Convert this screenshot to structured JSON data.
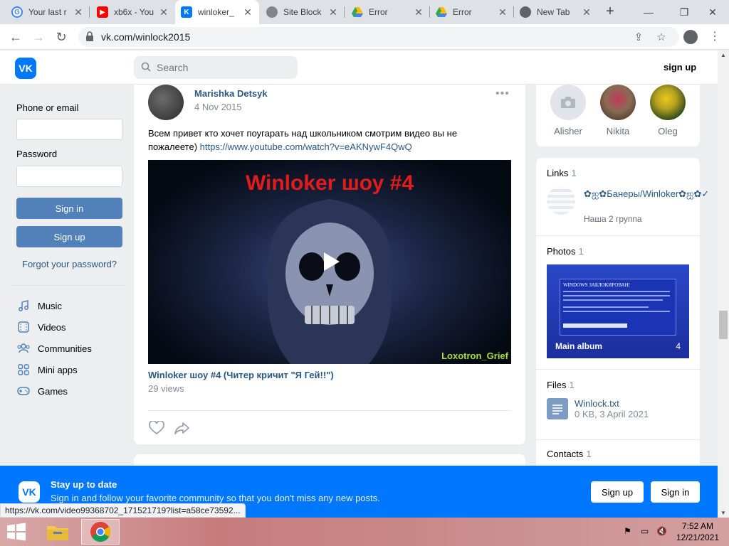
{
  "browser": {
    "tabs": [
      {
        "title": "Your last r",
        "favicon": "google-icon",
        "color": "#4285f4"
      },
      {
        "title": "xb6x - You",
        "favicon": "youtube-icon",
        "color": "#ff0000"
      },
      {
        "title": "winloker_",
        "favicon": "vk-icon",
        "color": "#0077ff"
      },
      {
        "title": "Site Block",
        "favicon": "blocked-site-icon",
        "color": "#5f6368"
      },
      {
        "title": "Error",
        "favicon": "google-drive-icon",
        "color": "#fbbc04"
      },
      {
        "title": "Error",
        "favicon": "google-drive-icon",
        "color": "#fbbc04"
      },
      {
        "title": "New Tab",
        "favicon": "chrome-icon",
        "color": "#5f6368"
      }
    ],
    "new_tab_label": "+",
    "url": "vk.com/winlock2015",
    "status_url": "https://vk.com/video99368702_171521719?list=a58ce73592..."
  },
  "vk": {
    "logo_text": "VK",
    "search_placeholder": "Search",
    "signup_top": "sign up",
    "login": {
      "phone_label": "Phone or email",
      "password_label": "Password",
      "signin_button": "Sign in",
      "signup_button": "Sign up",
      "forgot_link": "Forgot your password?"
    },
    "menu": [
      {
        "label": "Music",
        "icon": "music-note-icon"
      },
      {
        "label": "Videos",
        "icon": "video-icon"
      },
      {
        "label": "Communities",
        "icon": "communities-icon"
      },
      {
        "label": "Mini apps",
        "icon": "mini-apps-icon"
      },
      {
        "label": "Games",
        "icon": "gamepad-icon"
      }
    ],
    "post": {
      "author": "Marishka Detsyk",
      "date": "4 Nov 2015",
      "text": "Всем привет кто хочет поугарать над школьником смотрим видео вы не пожалеете)",
      "link": "https://www.youtube.com/watch?v=eAKNywF4QwQ",
      "video_title_overlay": "Winloker шоу #4",
      "video_watermark": "Loxotron_Grief",
      "video_caption": "Winloker шоу #4 (Читер кричит \"Я Гей!!\")",
      "views": "29 views"
    },
    "friends": [
      {
        "name": "Alisher",
        "color": "#dfe3e8"
      },
      {
        "name": "Nikita",
        "color": "#8a6b55"
      },
      {
        "name": "Oleg",
        "color": "#2c4a1a"
      }
    ],
    "links": {
      "title": "Links",
      "count": "1",
      "item_title": "✿ஐ✿Банеры/Winloker✿ஐ✿✓",
      "item_sub": "Наша 2 группа"
    },
    "photos": {
      "title": "Photos",
      "count": "1",
      "album_name": "Main album",
      "album_count": "4",
      "thumb_heading": "WINDOWS ЗАБЛОКИРОВАН!"
    },
    "files": {
      "title": "Files",
      "count": "1",
      "file_name": "Winlock.txt",
      "file_meta": "0 KB, 3 April 2021"
    },
    "contacts": {
      "title": "Contacts",
      "count": "1"
    },
    "banner": {
      "title": "Stay up to date",
      "subtitle": "Sign in and follow your favorite community so that you don't miss any new posts.",
      "signup": "Sign up",
      "signin": "Sign in"
    }
  },
  "taskbar": {
    "time": "7:52 AM",
    "date": "12/21/2021"
  }
}
